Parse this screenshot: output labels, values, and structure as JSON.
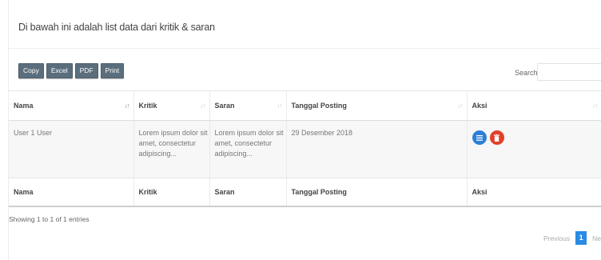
{
  "page": {
    "title": "Di bawah ini adalah list data dari kritik & saran"
  },
  "toolbar": {
    "buttons": [
      "Copy",
      "Excel",
      "PDF",
      "Print"
    ],
    "search_label": "Search:",
    "search_value": ""
  },
  "table": {
    "columns": [
      "Nama",
      "Kritik",
      "Saran",
      "Tanggal Posting",
      "Aksi"
    ],
    "rows": [
      {
        "nama": "User 1 User",
        "kritik": "Lorem ipsum dolor sit amet, consectetur adipiscing...",
        "saran": "Lorem ipsum dolor sit amet, consectetur adipiscing...",
        "tanggal": "29 Desember 2018",
        "actions": [
          "list-icon",
          "trash-icon"
        ]
      }
    ],
    "footer_columns": [
      "Nama",
      "Kritik",
      "Saran",
      "Tanggal Posting",
      "Aksi"
    ]
  },
  "footer": {
    "info": "Showing 1 to 1 of 1 entries",
    "pagination": {
      "previous": "Previous",
      "current": "1",
      "next": "Next"
    }
  },
  "colors": {
    "button_bg": "#5b6e7d",
    "detail_action": "#2d7fd6",
    "delete_action": "#e2402a",
    "page_current": "#2a8be3"
  }
}
